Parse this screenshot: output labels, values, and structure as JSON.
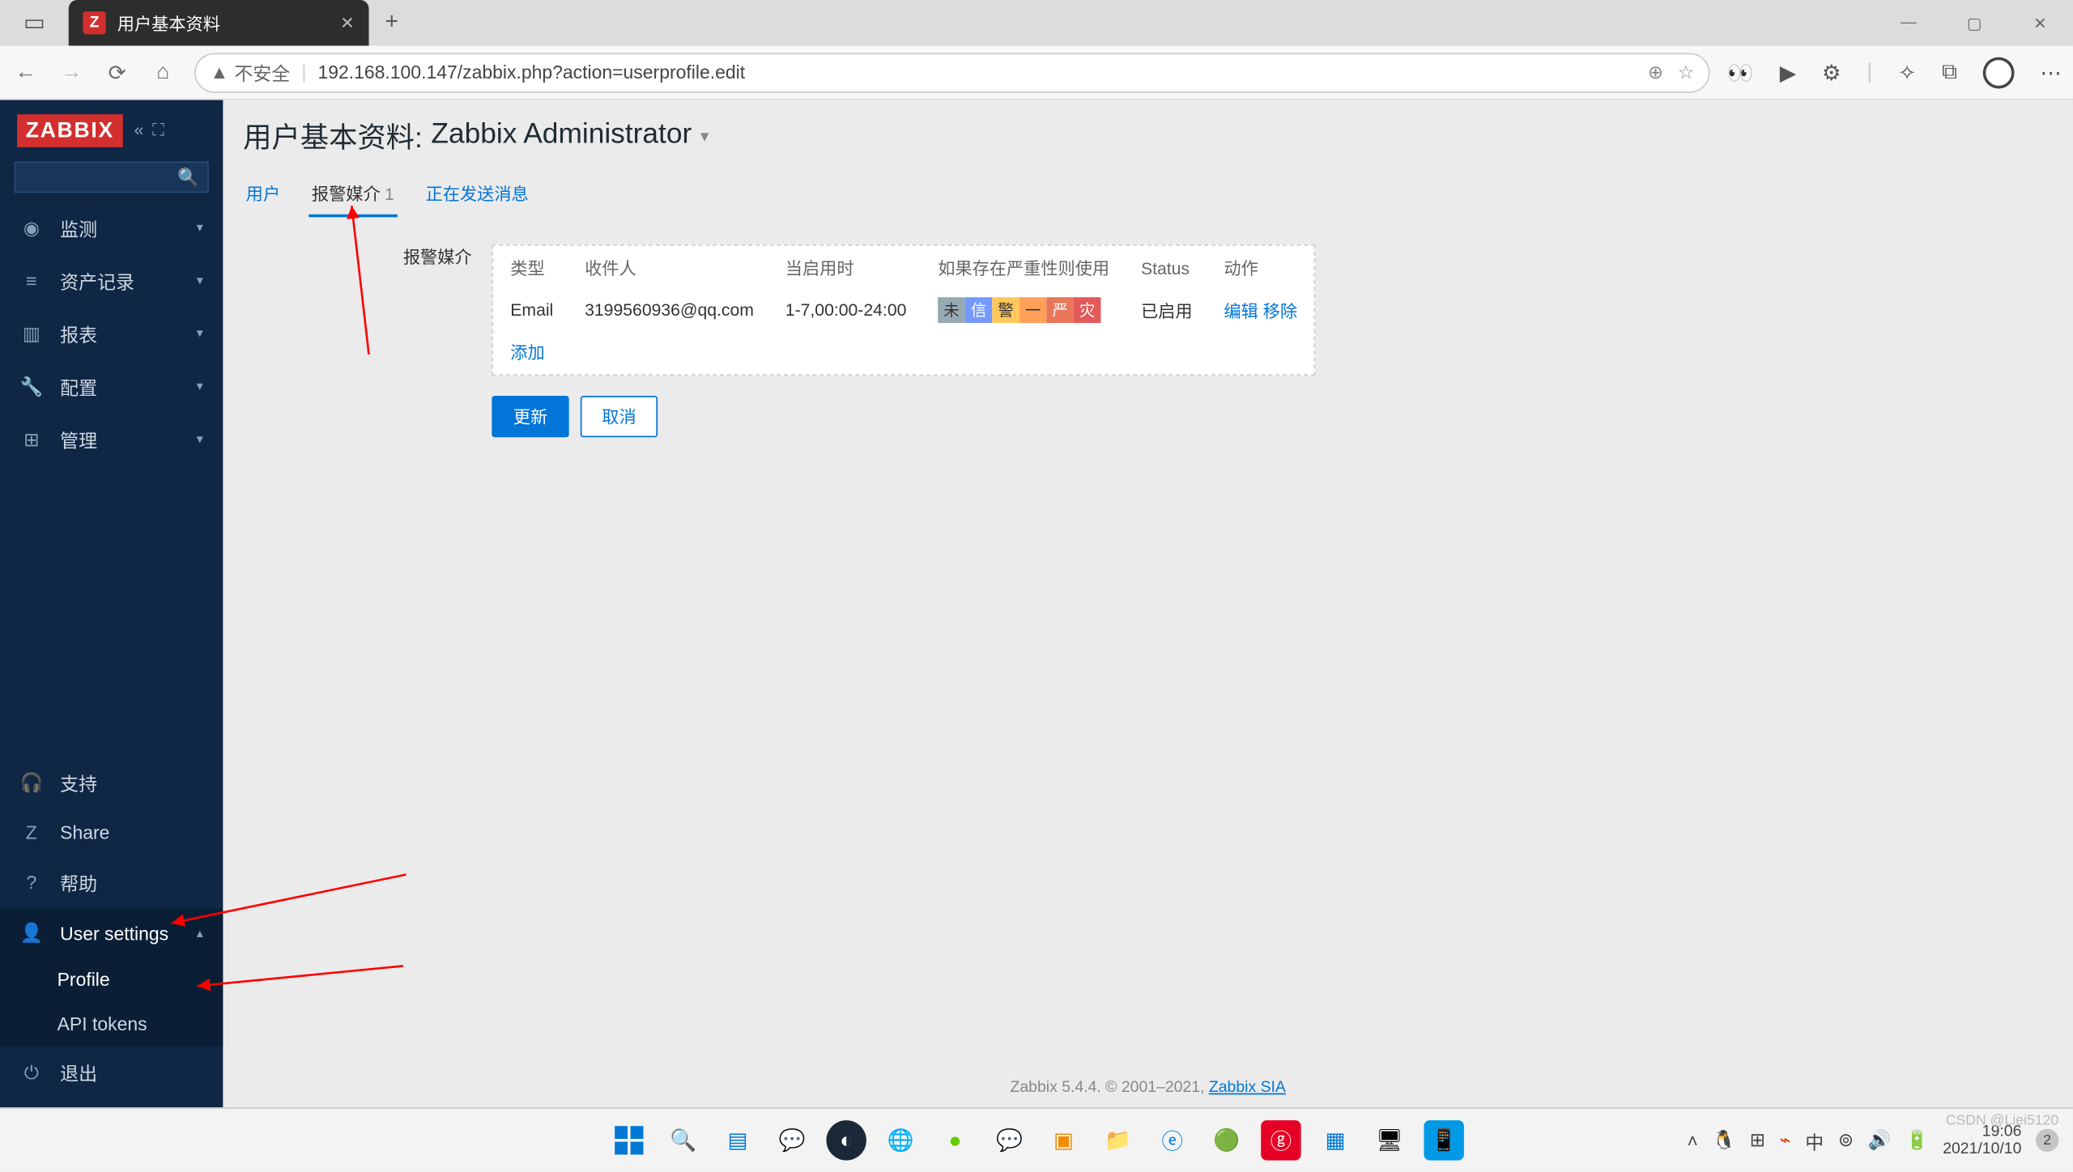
{
  "browser": {
    "tab_title": "用户基本资料",
    "insecure_label": "不安全",
    "url": "192.168.100.147/zabbix.php?action=userprofile.edit"
  },
  "sidebar": {
    "logo": "ZABBIX",
    "main": [
      {
        "icon": "◉",
        "label": "监测"
      },
      {
        "icon": "≡",
        "label": "资产记录"
      },
      {
        "icon": "▥",
        "label": "报表"
      },
      {
        "icon": "🔧",
        "label": "配置"
      },
      {
        "icon": "⊞",
        "label": "管理"
      }
    ],
    "support": {
      "icon": "🎧",
      "label": "支持"
    },
    "share": {
      "icon": "Z",
      "label": "Share"
    },
    "help": {
      "icon": "?",
      "label": "帮助"
    },
    "usersettings": {
      "icon": "👤",
      "label": "User settings"
    },
    "profile": "Profile",
    "apitokens": "API tokens",
    "logout": {
      "icon": "⏻",
      "label": "退出"
    }
  },
  "page": {
    "title_prefix": "用户基本资料: ",
    "title_name": "Zabbix Administrator",
    "tabs": {
      "user": "用户",
      "media": "报警媒介",
      "media_count": "1",
      "sending": "正在发送消息"
    },
    "formlabel": "报警媒介",
    "table": {
      "headers": {
        "type": "类型",
        "recipient": "收件人",
        "when": "当启用时",
        "severity": "如果存在严重性则使用",
        "status": "Status",
        "action": "动作"
      },
      "row": {
        "type": "Email",
        "recipient": "3199560936@qq.com",
        "when": "1-7,00:00-24:00",
        "severities": [
          "未",
          "信",
          "警",
          "一",
          "严",
          "灾"
        ],
        "status": "已启用",
        "edit": "编辑",
        "remove": "移除"
      },
      "add": "添加"
    },
    "buttons": {
      "update": "更新",
      "cancel": "取消"
    },
    "footer": {
      "text": "Zabbix 5.4.4. © 2001–2021, ",
      "link": "Zabbix SIA"
    }
  },
  "taskbar": {
    "tray": {
      "time": "19:06",
      "date": "2021/10/10",
      "ime": "中",
      "notif": "2"
    },
    "watermark": "CSDN @Liei5120"
  }
}
